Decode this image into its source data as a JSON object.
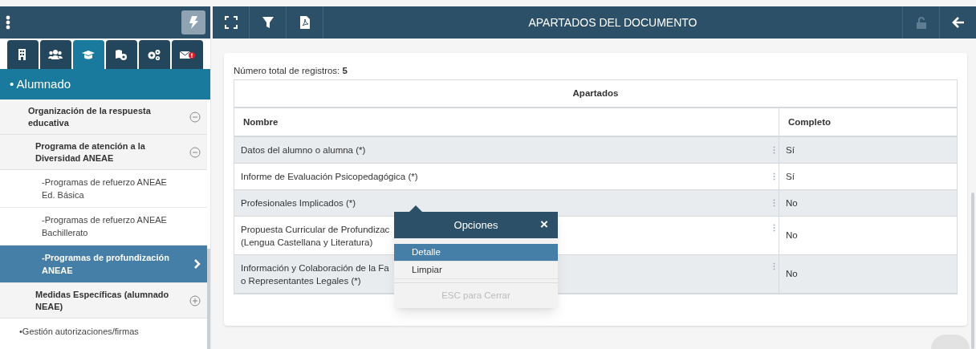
{
  "sidebar": {
    "tabs": [
      {
        "selected": false
      },
      {
        "selected": false
      },
      {
        "selected": true
      },
      {
        "selected": false
      },
      {
        "selected": false
      },
      {
        "selected": false
      }
    ],
    "section": "• Alumnado",
    "tree": [
      {
        "label": "Organización de la respuesta educativa",
        "expanded": true,
        "children": [
          {
            "label": "Programa de atención a la Diversidad ANEAE",
            "expanded": true,
            "children": [
              {
                "label": "-Programas de refuerzo ANEAE Ed. Básica",
                "selected": false
              },
              {
                "label": "-Programas de refuerzo ANEAE Bachillerato",
                "selected": false
              },
              {
                "label": "-Programas de profundización ANEAE",
                "selected": true
              }
            ]
          },
          {
            "label": "Medidas Específicas (alumnado NEAE)",
            "expanded": false
          }
        ]
      }
    ],
    "links": [
      "•Gestión autorizaciones/firmas"
    ]
  },
  "toolbar": {
    "title": "APARTADOS DEL DOCUMENTO",
    "lock_disabled": true
  },
  "record_count": {
    "label": "Número total de registros:",
    "value": "5"
  },
  "table": {
    "title": "Apartados",
    "columns": [
      "Nombre",
      "Completo"
    ],
    "rows": [
      {
        "nombre": "Datos del alumno o alumna (*)",
        "completo": "Sí"
      },
      {
        "nombre": "Informe de Evaluación Psicopedagógica (*)",
        "completo": "Sí"
      },
      {
        "nombre": "Profesionales Implicados (*)",
        "completo": "No"
      },
      {
        "nombre": "Propuesta Curricular de Profundizac\n(Lengua Castellana y Literatura)",
        "completo": "No"
      },
      {
        "nombre": "Información y Colaboración de la Fa\no Representantes Legales (*)",
        "completo": "No"
      }
    ]
  },
  "popup": {
    "title": "Opciones",
    "close": "×",
    "items": [
      {
        "label": "Detalle",
        "selected": true
      },
      {
        "label": "Limpiar",
        "selected": false
      }
    ],
    "footer": "ESC para Cerrar"
  }
}
